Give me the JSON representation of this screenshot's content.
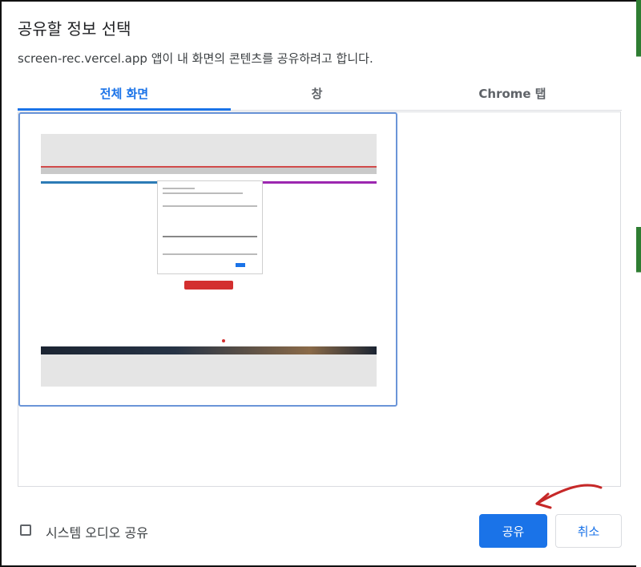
{
  "dialog": {
    "title": "공유할 정보 선택",
    "subtitle": "screen-rec.vercel.app 앱이 내 화면의 콘텐츠를 공유하려고 합니다."
  },
  "tabs": [
    {
      "label": "전체 화면",
      "selected": true
    },
    {
      "label": "창",
      "selected": false
    },
    {
      "label": "Chrome 탭",
      "selected": false
    }
  ],
  "sources": [
    {
      "type": "screen-thumbnail",
      "selected": true
    }
  ],
  "audio_checkbox": {
    "label": "시스템 오디오 공유",
    "checked": false
  },
  "buttons": {
    "share": "공유",
    "cancel": "취소"
  },
  "colors": {
    "accent": "#1a73e8",
    "annotation_arrow": "#c62828"
  }
}
